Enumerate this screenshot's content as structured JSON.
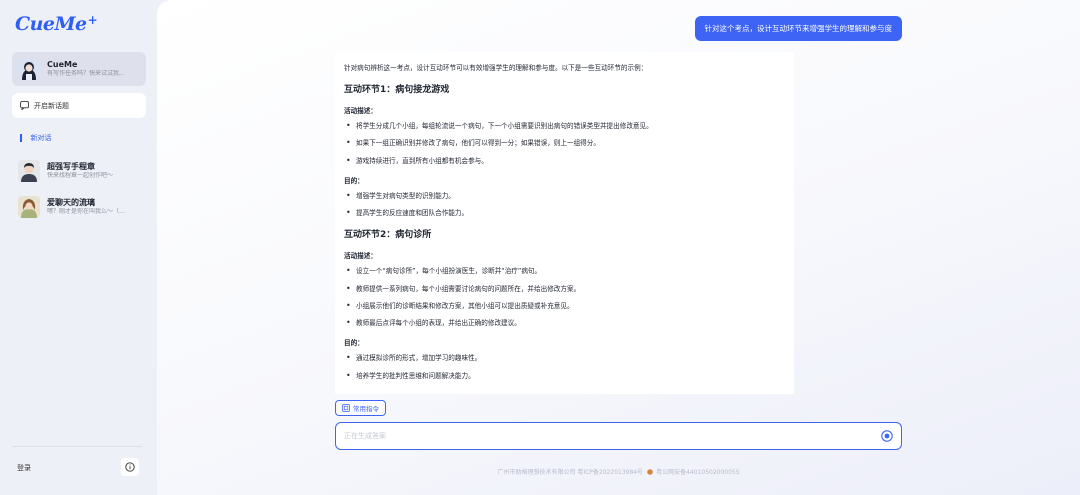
{
  "app": {
    "logo": "CueMe",
    "logo_plus": "+"
  },
  "sidebar": {
    "active_conversation": {
      "name": "CueMe",
      "subtitle": "有写作任务吗？快来试试我..."
    },
    "new_topic_label": "开启新话题",
    "section_title": "新对话",
    "conversations": [
      {
        "name": "超强写手程章",
        "subtitle": "快来找程章一起创作吧～"
      },
      {
        "name": "爱聊天的流璃",
        "subtitle": "嘿？刚才是你在叫我么～（..."
      }
    ],
    "login_label": "登录",
    "info_icon": "info-icon"
  },
  "chat": {
    "user_message": "针对这个考点，设计互动环节来增强学生的理解和参与度",
    "answer": {
      "intro": "针对病句辨析这一考点，设计互动环节可以有效增强学生的理解和参与度。以下是一些互动环节的示例：",
      "sections": [
        {
          "title": "互动环节1：病句接龙游戏",
          "desc_label": "活动描述：",
          "desc_items": [
            "将学生分成几个小组，每组轮流说一个病句，下一个小组需要识别出病句的错误类型并提出修改意见。",
            "如果下一组正确识别并修改了病句，他们可以得到一分；如果错误，则上一组得分。",
            "游戏持续进行，直到所有小组都有机会参与。"
          ],
          "goal_label": "目的：",
          "goal_items": [
            "增强学生对病句类型的识别能力。",
            "提高学生的反应速度和团队合作能力。"
          ]
        },
        {
          "title": "互动环节2：病句诊所",
          "desc_label": "活动描述：",
          "desc_items": [
            "设立一个“病句诊所”，每个小组扮演医生，诊断并“治疗”病句。",
            "教师提供一系列病句，每个小组需要讨论病句的问题所在，并给出修改方案。",
            "小组展示他们的诊断结果和修改方案，其他小组可以提出质疑或补充意见。",
            "教师最后点评每个小组的表现，并给出正确的修改建议。"
          ],
          "goal_label": "目的：",
          "goal_items": [
            "通过模拟诊所的形式，增加学习的趣味性。",
            "培养学生的批判性思维和问题解决能力。"
          ]
        }
      ]
    },
    "command_button": "常用指令",
    "input": {
      "value": "",
      "placeholder": "正在生成答案"
    }
  },
  "footer": {
    "company": "广州市助格理想技术有限公司 粤ICP备2022013984号",
    "police": "粤公网安备44010502000055"
  },
  "colors": {
    "accent": "#3d64f4",
    "logo": "#2f5ff2"
  }
}
